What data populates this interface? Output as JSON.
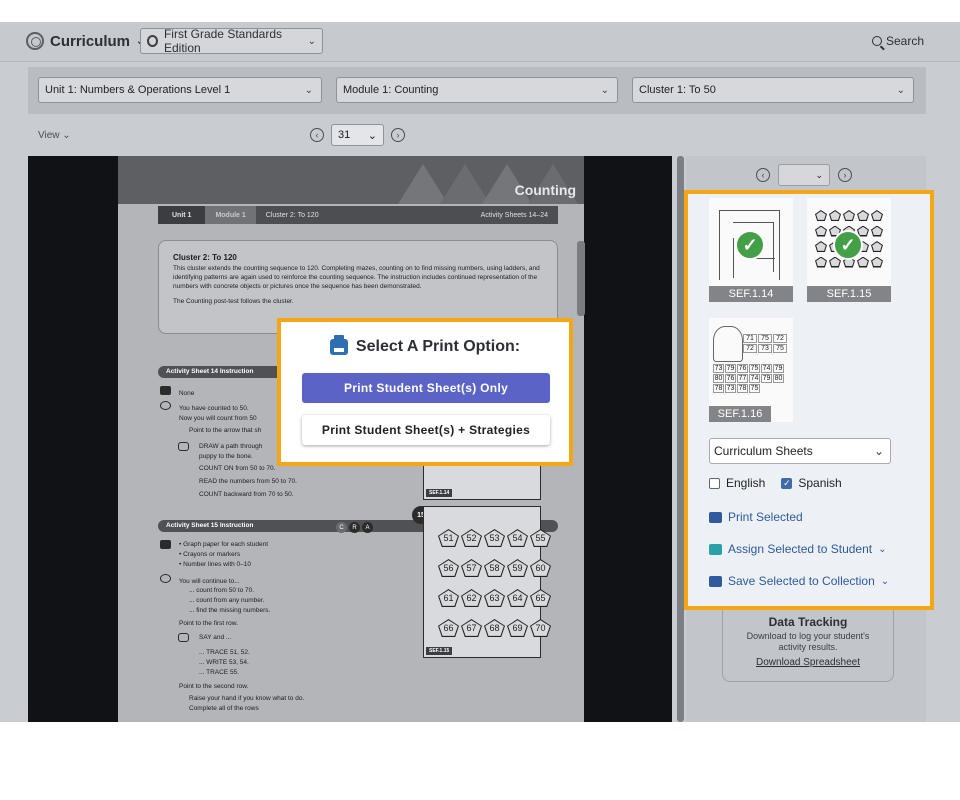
{
  "header": {
    "app_title": "Curriculum",
    "edition": "First Grade Standards Edition",
    "search_label": "Search"
  },
  "filters": {
    "unit": "Unit 1: Numbers & Operations Level 1",
    "module": "Module 1: Counting",
    "cluster": "Cluster 1: To 50"
  },
  "viewer_controls": {
    "view_label": "View",
    "page": "31"
  },
  "document": {
    "banner_title": "Counting",
    "tabs": [
      "Unit 1",
      "Module 1",
      "Cluster 2: To 120",
      "Activity Sheets 14–24"
    ],
    "cluster_title": "Cluster 2: To 120",
    "cluster_text": "This cluster extends the counting sequence to 120. Completing mazes, counting on to find missing numbers, using ladders, and identifying patterns are again used to reinforce the counting sequence. The instruction includes continued representation of the numbers with concrete objects or pictures once the sequence has been demonstrated.",
    "cluster_note": "The Counting post-test follows the cluster.",
    "sheet14": {
      "heading": "Activity Sheet 14 Instruction",
      "materials": "None",
      "lines": [
        "You have counted to 50.",
        "Now you will count from 50",
        "Point to the arrow that sh",
        "DRAW a path through",
        "puppy to the bone.",
        "COUNT ON from 50 to 70.",
        "READ the numbers from 50 to 70.",
        "COUNT backward from 70 to 50."
      ],
      "label": "SEF.1.14"
    },
    "sheet15": {
      "heading": "Activity Sheet 15 Instruction",
      "materials": [
        "• Graph paper for each student",
        "• Crayons or markers",
        "• Number lines with 0–10"
      ],
      "lines": [
        "You will continue to...",
        "... count from 50 to 70.",
        "... count from any number.",
        "... find the missing numbers.",
        "Point to the first row.",
        "SAY and ...",
        "... TRACE 51, 52.",
        "... WRITE 53, 54.",
        "... TRACE 55.",
        "Point to the second row.",
        "Raise your hand if you know what to do.",
        "Complete all of the rows"
      ],
      "cra": [
        "C",
        "R",
        "A"
      ],
      "number_badge": "15",
      "pentagons": [
        [
          "51",
          "52",
          "53",
          "54",
          "55"
        ],
        [
          "56",
          "57",
          "58",
          "59",
          "60"
        ],
        [
          "61",
          "62",
          "63",
          "64",
          "65"
        ],
        [
          "66",
          "67",
          "68",
          "69",
          "70"
        ]
      ],
      "label": "SEF.1.15"
    }
  },
  "modal": {
    "title": "Select A Print Option:",
    "option_only": "Print Student Sheet(s) Only",
    "option_strategies": "Print Student Sheet(s) + Strategies"
  },
  "print_panel": {
    "thumbnails": [
      {
        "label": "SEF.1.14",
        "selected": true
      },
      {
        "label": "SEF.1.15",
        "selected": true
      },
      {
        "label": "SEF.1.16",
        "selected": false
      }
    ],
    "thumb16_numbers": [
      "71",
      "75",
      "72",
      "72",
      "73",
      "75",
      "73",
      "79",
      "76",
      "75",
      "74",
      "79",
      "80",
      "76",
      "77",
      "74",
      "79",
      "80",
      "78",
      "73",
      "78",
      "75"
    ],
    "sheet_type": "Curriculum Sheets",
    "languages": [
      {
        "label": "English",
        "checked": false
      },
      {
        "label": "Spanish",
        "checked": true
      }
    ],
    "actions": {
      "print": "Print Selected",
      "assign": "Assign Selected to Student",
      "save": "Save Selected to Collection"
    }
  },
  "data_tracking": {
    "title": "Data Tracking",
    "description": "Download to log your student's activity results.",
    "link": "Download Spreadsheet"
  },
  "colors": {
    "highlight": "#f5a614",
    "primary_button": "#5b63c6",
    "link": "#2d5b9c",
    "check": "#43a047"
  }
}
